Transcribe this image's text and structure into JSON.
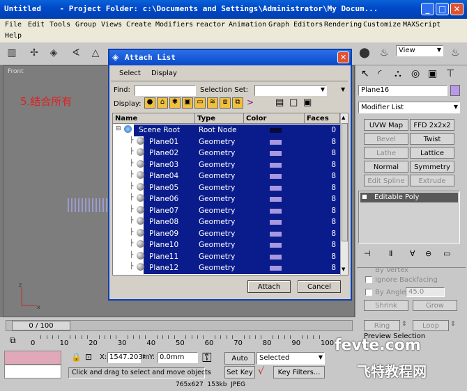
{
  "window": {
    "title": "Untitled    - Project Folder: c:\\Documents and Settings\\Administrator\\My Docum...",
    "min": "_",
    "max": "□",
    "close": "✕"
  },
  "menu": [
    "File",
    "Edit",
    "Tools",
    "Group",
    "Views",
    "Create",
    "Modifiers",
    "reactor",
    "Animation",
    "Graph Editors",
    "Rendering",
    "Customize",
    "MAXScript",
    "Help"
  ],
  "toolbar": {
    "view_dropdown": "View"
  },
  "viewport": {
    "label": "Front",
    "overlay_text": "5.结合所有",
    "axis_z": "z",
    "axis_x": "x"
  },
  "dialog": {
    "title": "Attach List",
    "close": "✕",
    "tabs": [
      "Select",
      "Display"
    ],
    "find_label": "Find:",
    "find_value": "",
    "selection_set_label": "Selection Set:",
    "display_label": "Display:",
    "columns": [
      "Name",
      "Type",
      "Color",
      "Faces"
    ],
    "rows": [
      {
        "name": "Scene Root",
        "type": "Root Node",
        "color": "#0a0a3a",
        "faces": "0"
      },
      {
        "name": "Plane01",
        "type": "Geometry",
        "color": "#a898e0",
        "faces": "8"
      },
      {
        "name": "Plane02",
        "type": "Geometry",
        "color": "#a898e0",
        "faces": "8"
      },
      {
        "name": "Plane03",
        "type": "Geometry",
        "color": "#a898e0",
        "faces": "8"
      },
      {
        "name": "Plane04",
        "type": "Geometry",
        "color": "#a898e0",
        "faces": "8"
      },
      {
        "name": "Plane05",
        "type": "Geometry",
        "color": "#a898e0",
        "faces": "8"
      },
      {
        "name": "Plane06",
        "type": "Geometry",
        "color": "#a898e0",
        "faces": "8"
      },
      {
        "name": "Plane07",
        "type": "Geometry",
        "color": "#a898e0",
        "faces": "8"
      },
      {
        "name": "Plane08",
        "type": "Geometry",
        "color": "#a898e0",
        "faces": "8"
      },
      {
        "name": "Plane09",
        "type": "Geometry",
        "color": "#a898e0",
        "faces": "8"
      },
      {
        "name": "Plane10",
        "type": "Geometry",
        "color": "#a898e0",
        "faces": "8"
      },
      {
        "name": "Plane11",
        "type": "Geometry",
        "color": "#a898e0",
        "faces": "8"
      },
      {
        "name": "Plane12",
        "type": "Geometry",
        "color": "#a898e0",
        "faces": "8"
      }
    ],
    "attach_label": "Attach",
    "cancel_label": "Cancel"
  },
  "command_panel": {
    "object_name": "Plane16",
    "modifier_list": "Modifier List",
    "buttons": [
      {
        "label": "UVW Map",
        "enabled": true
      },
      {
        "label": "FFD 2x2x2",
        "enabled": true
      },
      {
        "label": "Bevel",
        "enabled": false
      },
      {
        "label": "Twist",
        "enabled": true
      },
      {
        "label": "Lathe",
        "enabled": false
      },
      {
        "label": "Lattice",
        "enabled": true
      },
      {
        "label": "Normal",
        "enabled": true
      },
      {
        "label": "Symmetry",
        "enabled": true
      },
      {
        "label": "Edit Spline",
        "enabled": false
      },
      {
        "label": "Extrude",
        "enabled": false
      }
    ],
    "stack_item": "Editable Poly",
    "by_vertex": "By Vertex",
    "ignore_backfacing": "Ignore Backfacing",
    "by_angle_label": "By Angle:",
    "by_angle_value": "45.0",
    "shrink": "Shrink",
    "grow": "Grow",
    "ring": "Ring",
    "loop": "Loop",
    "preview_selection": "Preview Selection"
  },
  "timeline": {
    "frame_label": "0 / 100",
    "ticks": [
      "0",
      "10",
      "20",
      "30",
      "40",
      "50",
      "60",
      "70",
      "80",
      "90",
      "100"
    ]
  },
  "status": {
    "x_label": "X:",
    "x_value": "1547.203m",
    "y_label": "Y:",
    "y_value": "0.0mm",
    "auto_key": "Auto Key",
    "set_key": "Set Key",
    "selected": "Selected",
    "key_filters": "Key Filters...",
    "prompt": "Click and drag to select and move objects",
    "image_info": "765x627  153kb  JPEG"
  },
  "watermark": {
    "line1": "fevte.com",
    "line2": "飞特教程网"
  }
}
